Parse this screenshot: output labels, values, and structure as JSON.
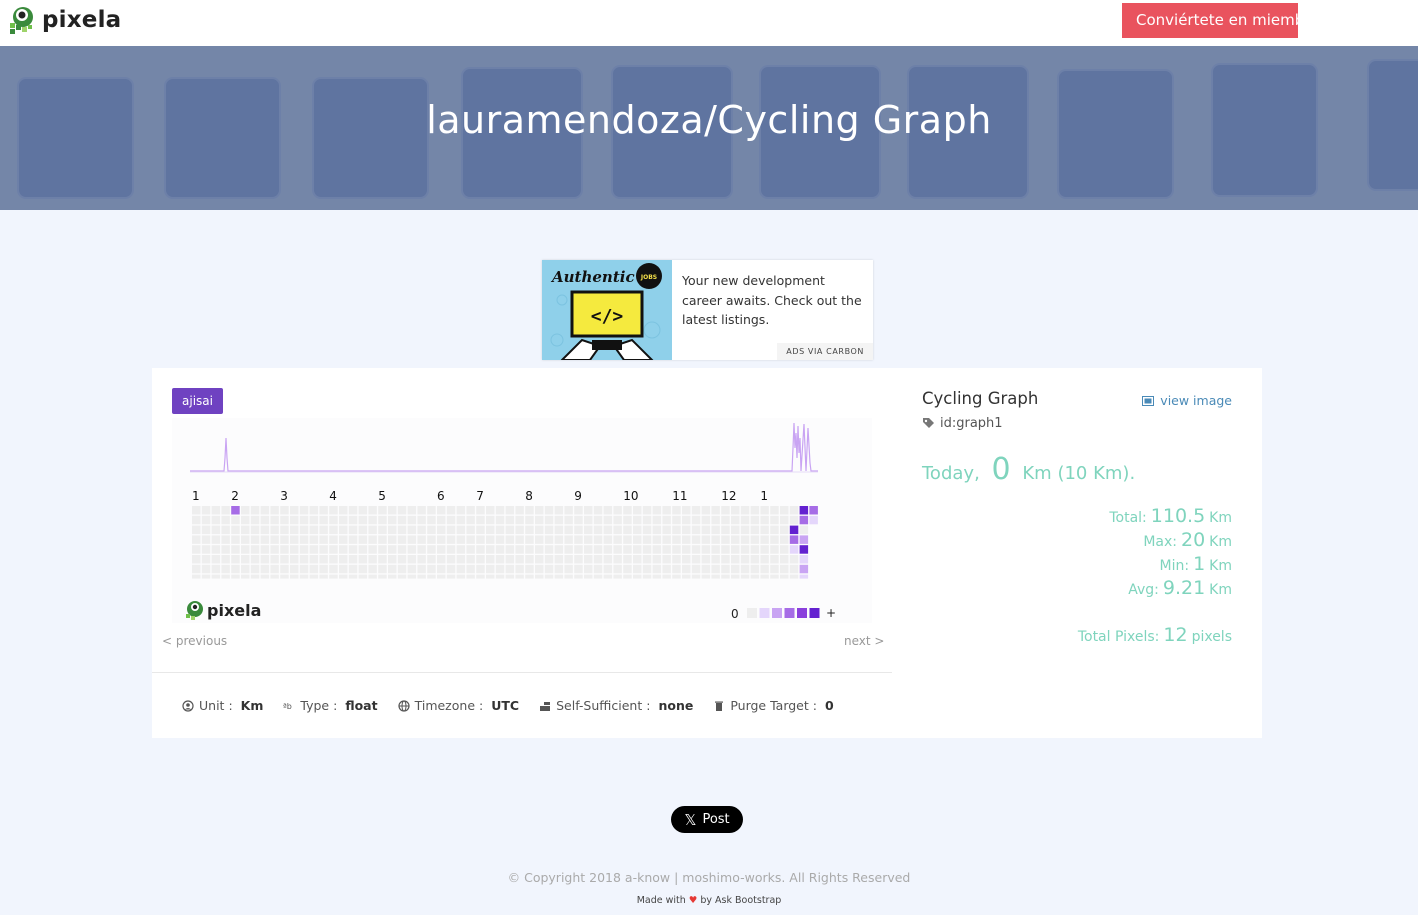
{
  "brand": {
    "name": "pixela"
  },
  "topbar": {
    "join_label": "Conviértete en miembro"
  },
  "hero": {
    "title": "lauramendoza/Cycling Graph"
  },
  "ad": {
    "brand_text": "Authentic",
    "badge_text": "JOBS",
    "text": "Your new development career awaits. Check out the latest listings.",
    "via": "ADS VIA CARBON"
  },
  "graph": {
    "theme_label": "ajisai",
    "months": [
      "1",
      "2",
      "3",
      "4",
      "5",
      "6",
      "7",
      "8",
      "9",
      "10",
      "11",
      "12",
      "1"
    ],
    "legend_zero": "0",
    "legend_plus": "+",
    "logo_text": "pixela",
    "prev_label": "< previous",
    "next_label": "next >",
    "colors": {
      "empty": "#eeeeee",
      "l1": "#e4d6fb",
      "l2": "#c9a4f3",
      "l3": "#a66ce6",
      "l4": "#8a3fdc",
      "l5": "#6321d0"
    }
  },
  "properties": [
    {
      "icon": "user-circle-icon",
      "label": "Unit",
      "value": "Km"
    },
    {
      "icon": "type-icon",
      "label": "Type",
      "value": "float"
    },
    {
      "icon": "globe-icon",
      "label": "Timezone",
      "value": "UTC"
    },
    {
      "icon": "self-sufficient-icon",
      "label": "Self-Sufficient",
      "value": "none"
    },
    {
      "icon": "trash-icon",
      "label": "Purge Target",
      "value": "0"
    }
  ],
  "side": {
    "title": "Cycling Graph",
    "view_image": "view image",
    "graph_id": "id:graph1",
    "today_label": "Today",
    "today_comma": ",",
    "today_value": "0",
    "today_unit": "Km",
    "today_extra": "(10 Km).",
    "stats": [
      {
        "label": "Total:",
        "value": "110.5",
        "unit": "Km"
      },
      {
        "label": "Max:",
        "value": "20",
        "unit": "Km"
      },
      {
        "label": "Min:",
        "value": "1",
        "unit": "Km"
      },
      {
        "label": "Avg:",
        "value": "9.21",
        "unit": "Km"
      }
    ],
    "pixels_label": "Total Pixels:",
    "pixels_value": "12",
    "pixels_unit": "pixels"
  },
  "share": {
    "post_label": "Post"
  },
  "footer": {
    "copyright": "© Copyright 2018 a-know | moshimo-works. All Rights Reserved",
    "made_with": "Made with",
    "by": "by Ask Bootstrap"
  }
}
